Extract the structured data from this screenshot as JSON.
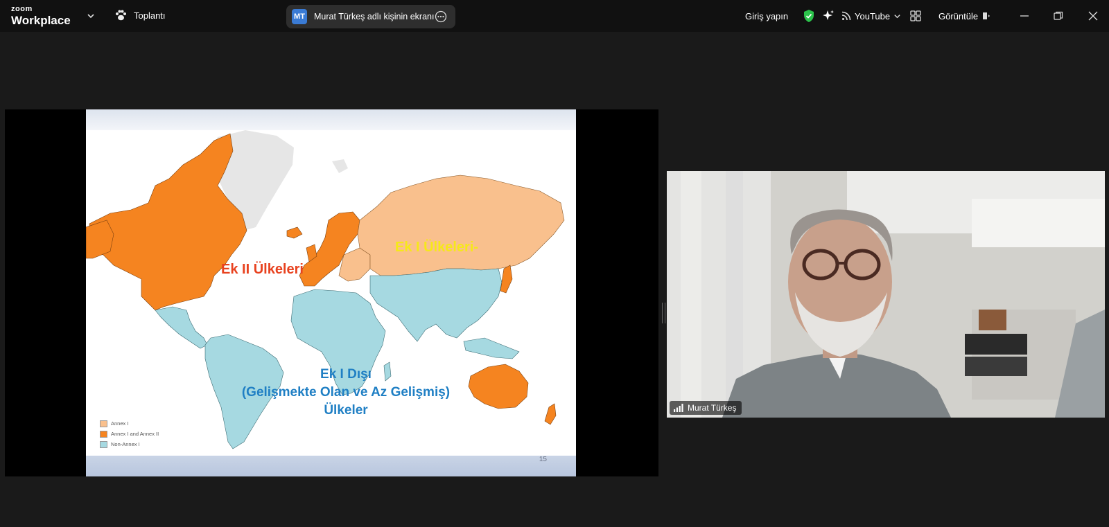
{
  "app": {
    "brand_top": "zoom",
    "brand_bottom": "Workplace"
  },
  "meeting": {
    "label": "Toplantı"
  },
  "share": {
    "avatar": "MT",
    "text": "Murat Türkeş adlı kişinin ekranı"
  },
  "toolbar": {
    "signin": "Giriş yapın",
    "youtube": "YouTube",
    "view": "Görüntüle"
  },
  "colors": {
    "annex1": "#f9c08d",
    "annex2": "#f58420",
    "nonannex": "#a6d9e1",
    "greenland": "#e6e6e6"
  },
  "slide": {
    "label_annex2": "Ek II Ülkeleri",
    "label_annex1": "Ek I Ülkeleri-",
    "label_nonannex": [
      "Ek I Dışı",
      "(Gelişmekte Olan ve Az Gelişmiş)",
      "Ülkeler"
    ],
    "legend": [
      {
        "label": "Annex I",
        "color": "#f9c08d"
      },
      {
        "label": "Annex I and Annex II",
        "color": "#f58420"
      },
      {
        "label": "Non-Annex I",
        "color": "#a6d9e1"
      }
    ],
    "page_number": "15"
  },
  "participant": {
    "name": "Murat Türkeş"
  }
}
